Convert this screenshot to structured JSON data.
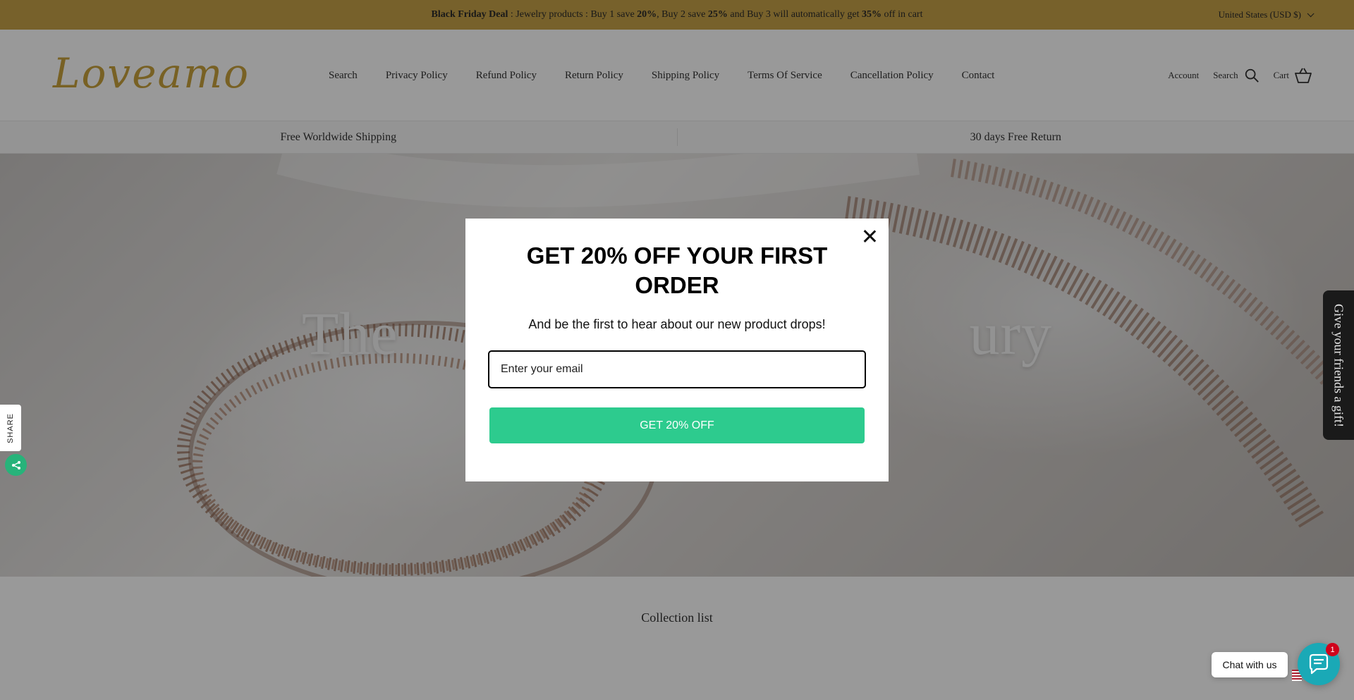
{
  "announcement": {
    "deal_label": "Black Friday Deal",
    "text_1": " : Jewelry products : Buy 1 save ",
    "pct_1": "20%",
    "text_2": ", Buy 2 save ",
    "pct_2": "25%",
    "text_3": " and Buy 3 will automatically get ",
    "pct_3": "35%",
    "text_4": " off in cart",
    "currency": "United States (USD $)"
  },
  "header": {
    "logo": "Loveamo",
    "nav": [
      "Search",
      "Privacy Policy",
      "Refund Policy",
      "Return Policy",
      "Shipping Policy",
      "Terms Of Service",
      "Cancellation Policy",
      "Contact"
    ],
    "account": "Account",
    "search": "Search",
    "cart": "Cart"
  },
  "features": [
    "Free Worldwide Shipping",
    "30 days Free Return"
  ],
  "hero": {
    "title": "The                                    ury"
  },
  "collection": {
    "title": "Collection list"
  },
  "popup": {
    "title": "GET 20% OFF YOUR FIRST ORDER",
    "subtitle": "And be the first to hear about our new product drops!",
    "email_placeholder": "Enter your email",
    "button": "GET 20% OFF"
  },
  "share": {
    "label": "SHARE"
  },
  "gift": {
    "label": "Give your friends a gift!"
  },
  "chat": {
    "label": "Chat with us",
    "badge": "1"
  },
  "colors": {
    "announcement_bg": "#c7a248",
    "logo": "#c9a23d",
    "popup_button": "#2dcb8e",
    "chat_button": "#1aa9b6"
  }
}
